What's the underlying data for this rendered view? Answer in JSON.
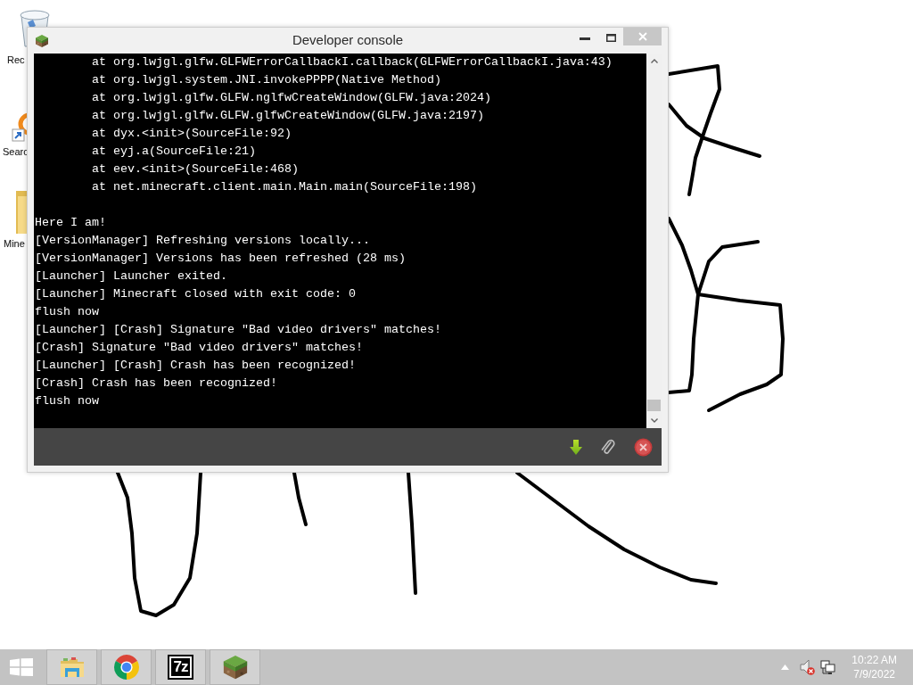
{
  "desktop": {
    "icons": [
      {
        "kind": "bin",
        "label": "Rec"
      },
      {
        "kind": "shortcut",
        "label": "Searc"
      },
      {
        "kind": "folder",
        "label": "Mine"
      }
    ]
  },
  "window": {
    "title": "Developer console",
    "console": {
      "lines": [
        {
          "kind": "trace",
          "text": "at org.lwjgl.glfw.GLFWErrorCallbackI.callback(GLFWErrorCallbackI.java:43)"
        },
        {
          "kind": "trace",
          "text": "at org.lwjgl.system.JNI.invokePPPP(Native Method)"
        },
        {
          "kind": "trace",
          "text": "at org.lwjgl.glfw.GLFW.nglfwCreateWindow(GLFW.java:2024)"
        },
        {
          "kind": "trace",
          "text": "at org.lwjgl.glfw.GLFW.glfwCreateWindow(GLFW.java:2197)"
        },
        {
          "kind": "trace",
          "text": "at dyx.<init>(SourceFile:92)"
        },
        {
          "kind": "trace",
          "text": "at eyj.a(SourceFile:21)"
        },
        {
          "kind": "trace",
          "text": "at eev.<init>(SourceFile:468)"
        },
        {
          "kind": "trace",
          "text": "at net.minecraft.client.main.Main.main(SourceFile:198)"
        },
        {
          "kind": "blank"
        },
        {
          "kind": "log",
          "text": "Here I am!"
        },
        {
          "kind": "log",
          "text": "[VersionManager] Refreshing versions locally..."
        },
        {
          "kind": "log",
          "text": "[VersionManager] Versions has been refreshed (28 ms)"
        },
        {
          "kind": "log",
          "text": "[Launcher] Launcher exited."
        },
        {
          "kind": "log",
          "text": "[Launcher] Minecraft closed with exit code: 0"
        },
        {
          "kind": "log",
          "text": "flush now"
        },
        {
          "kind": "log",
          "text": "[Launcher] [Crash] Signature \"Bad video drivers\" matches!"
        },
        {
          "kind": "log",
          "text": "[Crash] Signature \"Bad video drivers\" matches!"
        },
        {
          "kind": "log",
          "text": "[Launcher] [Crash] Crash has been recognized!"
        },
        {
          "kind": "log",
          "text": "[Crash] Crash has been recognized!"
        },
        {
          "kind": "log",
          "text": "flush now"
        }
      ]
    }
  },
  "taskbar": {
    "pinned": [
      {
        "kind": "folder"
      },
      {
        "kind": "browser"
      },
      {
        "kind": "text-logo",
        "logo_text": "7z"
      },
      {
        "kind": "block"
      }
    ],
    "tray": {
      "volume": {
        "muted": true
      },
      "time": "10:22 AM",
      "date": "7/9/2022"
    }
  }
}
